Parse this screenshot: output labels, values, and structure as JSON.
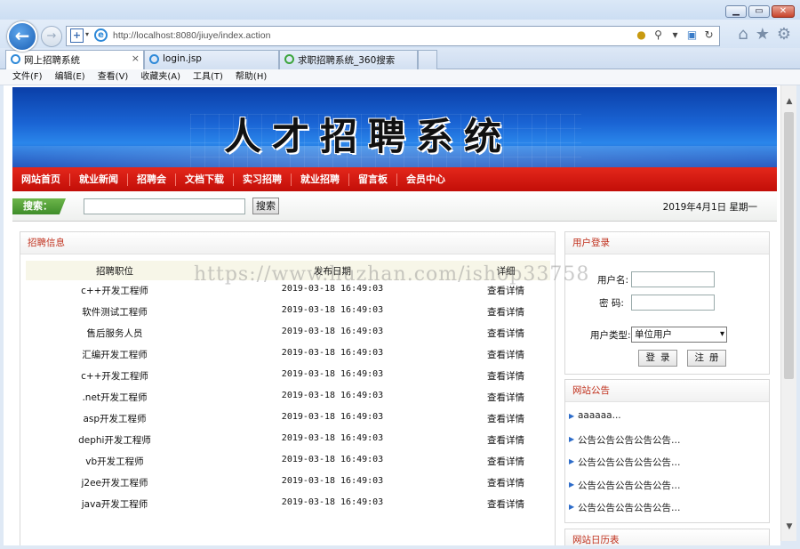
{
  "browser": {
    "address": "http://localhost:8080/jiuye/index.action",
    "tabs": [
      {
        "label": "网上招聘系统",
        "active": true
      },
      {
        "label": "login.jsp",
        "active": false
      },
      {
        "label": "求职招聘系统_360搜索",
        "active": false
      }
    ],
    "menu": [
      "文件(F)",
      "编辑(E)",
      "查看(V)",
      "收藏夹(A)",
      "工具(T)",
      "帮助(H)"
    ]
  },
  "site": {
    "banner_title": "人才招聘系统",
    "nav": [
      "网站首页",
      "就业新闻",
      "招聘会",
      "文档下载",
      "实习招聘",
      "就业招聘",
      "留言板",
      "会员中心"
    ],
    "search_label": "搜索：",
    "search_button": "搜索",
    "date": "2019年4月1日  星期一"
  },
  "jobs": {
    "title": "招聘信息",
    "columns": [
      "招聘职位",
      "发布日期",
      "详细"
    ],
    "rows": [
      {
        "position": "c++开发工程师",
        "date": "2019-03-18 16:49:03",
        "action": "查看详情"
      },
      {
        "position": "软件测试工程师",
        "date": "2019-03-18 16:49:03",
        "action": "查看详情"
      },
      {
        "position": "售后服务人员",
        "date": "2019-03-18 16:49:03",
        "action": "查看详情"
      },
      {
        "position": "汇编开发工程师",
        "date": "2019-03-18 16:49:03",
        "action": "查看详情"
      },
      {
        "position": "c++开发工程师",
        "date": "2019-03-18 16:49:03",
        "action": "查看详情"
      },
      {
        "position": ".net开发工程师",
        "date": "2019-03-18 16:49:03",
        "action": "查看详情"
      },
      {
        "position": "asp开发工程师",
        "date": "2019-03-18 16:49:03",
        "action": "查看详情"
      },
      {
        "position": "dephi开发工程师",
        "date": "2019-03-18 16:49:03",
        "action": "查看详情"
      },
      {
        "position": "vb开发工程师",
        "date": "2019-03-18 16:49:03",
        "action": "查看详情"
      },
      {
        "position": "j2ee开发工程师",
        "date": "2019-03-18 16:49:03",
        "action": "查看详情"
      },
      {
        "position": "java开发工程师",
        "date": "2019-03-18 16:49:03",
        "action": "查看详情"
      }
    ]
  },
  "login": {
    "title": "用户登录",
    "username_label": "用户名:",
    "password_label": "密  码:",
    "usertype_label": "用户类型:",
    "usertype_value": "单位用户",
    "login_button": "登录",
    "register_button": "注册"
  },
  "notice": {
    "title": "网站公告",
    "items": [
      "aaaaaa...",
      "公告公告公告公告公告…",
      "公告公告公告公告公告…",
      "公告公告公告公告公告…",
      "公告公告公告公告公告…"
    ]
  },
  "calendar": {
    "title": "网站日历表"
  },
  "watermark": "https://www.huzhan.com/ishop33758"
}
